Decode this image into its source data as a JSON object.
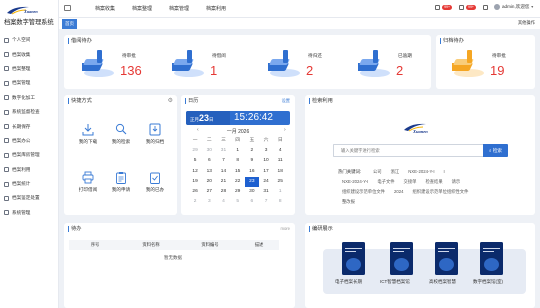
{
  "app": {
    "logo_text": "Xuanen",
    "system_name": "档案数字管理系统"
  },
  "menu": [
    {
      "label": "个人空间"
    },
    {
      "label": "档案收集"
    },
    {
      "label": "档案整理"
    },
    {
      "label": "档案管理"
    },
    {
      "label": "数字化加工"
    },
    {
      "label": "系统监督检查"
    },
    {
      "label": "长期保存"
    },
    {
      "label": "档案办公"
    },
    {
      "label": "档案库房管理"
    },
    {
      "label": "档案利用"
    },
    {
      "label": "档案统计"
    },
    {
      "label": "档案鉴定处置"
    },
    {
      "label": "系统管理"
    }
  ],
  "topnav": [
    {
      "label": "档案收集"
    },
    {
      "label": "档案整理"
    },
    {
      "label": "档案管理"
    },
    {
      "label": "档案利用"
    }
  ],
  "toolbar": {
    "badge1": "99+",
    "badge2": "99+",
    "username": "admin,欢迎您"
  },
  "tabs": {
    "home": "首页",
    "more_ops": "其他操作"
  },
  "pending": {
    "title": "借阅待办",
    "items": [
      {
        "label": "待审批",
        "value": "136"
      },
      {
        "label": "待借阅",
        "value": "1"
      },
      {
        "label": "待归还",
        "value": "2"
      },
      {
        "label": "已逾期",
        "value": "2"
      }
    ]
  },
  "archive_pending": {
    "title": "归档待办",
    "label": "待审批",
    "value": "19"
  },
  "quick": {
    "title": "快捷方式",
    "items": [
      {
        "label": "我的下载",
        "icon": "download-icon"
      },
      {
        "label": "我的检索",
        "icon": "search-icon"
      },
      {
        "label": "我的归档",
        "icon": "inbox-icon"
      },
      {
        "label": "打印借阅",
        "icon": "printer-icon"
      },
      {
        "label": "我的申请",
        "icon": "clipboard-icon"
      },
      {
        "label": "我的已办",
        "icon": "task-icon"
      }
    ]
  },
  "calendar": {
    "title": "日历",
    "settings": "设置",
    "date_prefix": "正月",
    "day": "23",
    "weekday": "日",
    "time": "15:26:42",
    "month_label": "一月 2026",
    "weekdays": [
      "一",
      "二",
      "三",
      "四",
      "五",
      "六",
      "日"
    ],
    "days": [
      {
        "d": "29",
        "dim": true
      },
      {
        "d": "30",
        "dim": true
      },
      {
        "d": "31",
        "dim": true
      },
      {
        "d": "1"
      },
      {
        "d": "2"
      },
      {
        "d": "3"
      },
      {
        "d": "4"
      },
      {
        "d": "5"
      },
      {
        "d": "6"
      },
      {
        "d": "7"
      },
      {
        "d": "8"
      },
      {
        "d": "9"
      },
      {
        "d": "10"
      },
      {
        "d": "11"
      },
      {
        "d": "12"
      },
      {
        "d": "13"
      },
      {
        "d": "14"
      },
      {
        "d": "15"
      },
      {
        "d": "16"
      },
      {
        "d": "17"
      },
      {
        "d": "18"
      },
      {
        "d": "19"
      },
      {
        "d": "20"
      },
      {
        "d": "21"
      },
      {
        "d": "22"
      },
      {
        "d": "23",
        "sel": true
      },
      {
        "d": "24"
      },
      {
        "d": "25"
      },
      {
        "d": "26"
      },
      {
        "d": "27"
      },
      {
        "d": "28"
      },
      {
        "d": "29"
      },
      {
        "d": "30"
      },
      {
        "d": "31"
      },
      {
        "d": "1",
        "dim": true
      },
      {
        "d": "2",
        "dim": true
      },
      {
        "d": "3",
        "dim": true
      },
      {
        "d": "4",
        "dim": true
      },
      {
        "d": "5",
        "dim": true
      },
      {
        "d": "6",
        "dim": true
      },
      {
        "d": "7",
        "dim": true
      },
      {
        "d": "8",
        "dim": true
      }
    ]
  },
  "search": {
    "title": "检索利用",
    "logo_text": "Xuanen",
    "placeholder": "输入关键字进行检索",
    "button": "检索",
    "hot_label": "热门关键词:",
    "hot_row1": [
      "公司",
      "浙江",
      "NXE-2024-Y-I",
      "I"
    ],
    "hot_row2": [
      "NXE-2024-Y-I",
      "电子文件",
      "交接单",
      "检查结果",
      "请示"
    ],
    "hot_row3": [
      "组织建设示范单位文件",
      "2024",
      "组织建设示范单位组织性文件"
    ],
    "hot_row4": [
      "整改报"
    ]
  },
  "todo": {
    "title": "待办",
    "more": "more",
    "columns": [
      "序号",
      "资料名称",
      "资料编号",
      "描述"
    ],
    "empty": "暂无数据"
  },
  "promo": {
    "title": "编研展示",
    "labels": [
      "电子档案长期",
      "ICT智慧档案馆",
      "高校档案智慧",
      "数字档案馆(室)"
    ]
  },
  "colors": {
    "primary": "#2f6fd0",
    "danger": "#e53935"
  }
}
